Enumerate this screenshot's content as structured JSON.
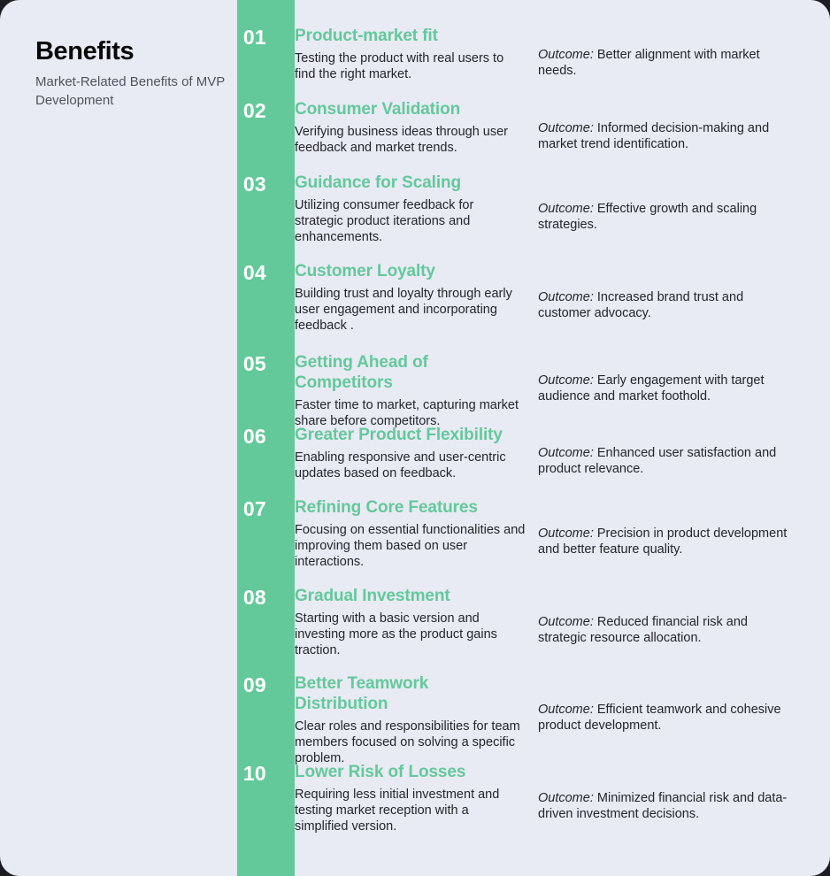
{
  "theme": {
    "background": "#e8eaf4",
    "accent_green": "#63c99a",
    "title_color": "#080808",
    "body_color": "#24262b",
    "subtitle_color": "#51545e",
    "number_color": "#ffffff"
  },
  "header": {
    "title": "Benefits",
    "subtitle": "Market-Related Benefits of MVP Development"
  },
  "outcome_label": "Outcome:",
  "rows": [
    {
      "number": "01",
      "title": "Product-market fit",
      "description": "Testing the product with real users to find the right market.",
      "outcome": " Better alignment with market needs."
    },
    {
      "number": "02",
      "title": "Consumer Validation",
      "description": "Verifying business ideas through user feedback and market trends.",
      "outcome": " Informed decision-making and market trend identification."
    },
    {
      "number": "03",
      "title": "Guidance for Scaling",
      "description": "Utilizing consumer feedback for strategic product iterations and enhancements.",
      "outcome": " Effective growth and scaling strategies."
    },
    {
      "number": "04",
      "title": "Customer Loyalty",
      "description": "Building trust and loyalty through early user engagement and incorporating feedback .",
      "outcome": " Increased brand trust and customer advocacy."
    },
    {
      "number": "05",
      "title": "Getting Ahead of Competitors",
      "description": "Faster time to market, capturing market share before competitors.",
      "outcome": " Early engagement with target audience and market foothold."
    },
    {
      "number": "06",
      "title": "Greater Product Flexibility",
      "description": "Enabling responsive and user-centric updates based on feedback.",
      "outcome": " Enhanced user satisfaction and product relevance."
    },
    {
      "number": "07",
      "title": "Refining Core Features",
      "description": "Focusing on essential functionalities and improving them based on user interactions.",
      "outcome": " Precision in product development and better feature quality."
    },
    {
      "number": "08",
      "title": "Gradual Investment",
      "description": "Starting with a basic version and investing more as the product gains traction.",
      "outcome": " Reduced financial risk and strategic resource allocation."
    },
    {
      "number": "09",
      "title": "Better Teamwork Distribution",
      "description": "Clear roles and responsibilities for team members focused on solving a specific problem.",
      "outcome": " Efficient teamwork and cohesive product development."
    },
    {
      "number": "10",
      "title": "Lower Risk of Losses",
      "description": "Requiring less initial investment and testing market reception with a simplified version.",
      "outcome": " Minimized financial risk and data-driven investment decisions."
    }
  ]
}
